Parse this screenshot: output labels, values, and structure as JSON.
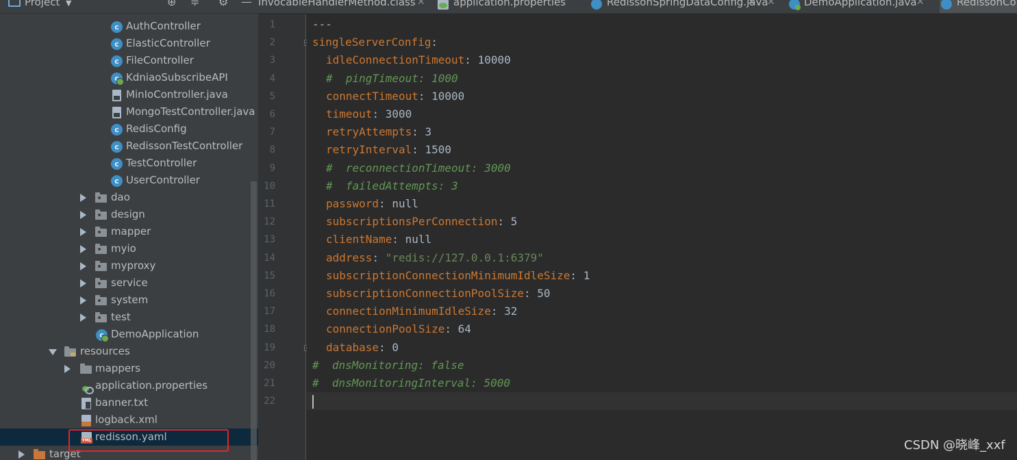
{
  "sidebar": {
    "title": "Project",
    "items": [
      {
        "label": "AuthController",
        "icon": "class"
      },
      {
        "label": "ElasticController",
        "icon": "class"
      },
      {
        "label": "FileController",
        "icon": "class"
      },
      {
        "label": "KdniaoSubscribeAPI",
        "icon": "spring"
      },
      {
        "label": "MinIoController.java",
        "icon": "java-file"
      },
      {
        "label": "MongoTestController.java",
        "icon": "java-file"
      },
      {
        "label": "RedisConfig",
        "icon": "class"
      },
      {
        "label": "RedissonTestController",
        "icon": "class"
      },
      {
        "label": "TestController",
        "icon": "class"
      },
      {
        "label": "UserController",
        "icon": "class"
      },
      {
        "label": "dao",
        "icon": "package"
      },
      {
        "label": "design",
        "icon": "package"
      },
      {
        "label": "mapper",
        "icon": "package"
      },
      {
        "label": "myio",
        "icon": "package"
      },
      {
        "label": "myproxy",
        "icon": "package"
      },
      {
        "label": "service",
        "icon": "package"
      },
      {
        "label": "system",
        "icon": "package"
      },
      {
        "label": "test",
        "icon": "package"
      },
      {
        "label": "DemoApplication",
        "icon": "spring"
      },
      {
        "label": "resources",
        "icon": "resources-folder"
      },
      {
        "label": "mappers",
        "icon": "folder"
      },
      {
        "label": "application.properties",
        "icon": "properties"
      },
      {
        "label": "banner.txt",
        "icon": "text-file"
      },
      {
        "label": "logback.xml",
        "icon": "xml-file"
      },
      {
        "label": "redisson.yaml",
        "icon": "yaml-file"
      },
      {
        "label": "target",
        "icon": "excluded-folder"
      }
    ]
  },
  "tabs": [
    {
      "label": "InvocableHandlerMethod.class"
    },
    {
      "label": "application.properties"
    },
    {
      "label": "RedissonSpringDataConfig.java"
    },
    {
      "label": "DemoApplication.java"
    },
    {
      "label": "RedissonCo"
    }
  ],
  "editor": {
    "line_numbers": [
      "1",
      "2",
      "3",
      "4",
      "5",
      "6",
      "7",
      "8",
      "9",
      "10",
      "11",
      "12",
      "13",
      "14",
      "15",
      "16",
      "17",
      "18",
      "19",
      "20",
      "21",
      "22"
    ],
    "lines": [
      {
        "key": "",
        "value": "---"
      },
      {
        "key": "singleServerConfig",
        "value": ""
      },
      {
        "key": "idleConnectionTimeout",
        "value": "10000"
      },
      {
        "comment": "#  pingTimeout: 1000"
      },
      {
        "key": "connectTimeout",
        "value": "10000"
      },
      {
        "key": "timeout",
        "value": "3000"
      },
      {
        "key": "retryAttempts",
        "value": "3"
      },
      {
        "key": "retryInterval",
        "value": "1500"
      },
      {
        "comment": "#  reconnectionTimeout: 3000"
      },
      {
        "comment": "#  failedAttempts: 3"
      },
      {
        "key": "password",
        "value": "null"
      },
      {
        "key": "subscriptionsPerConnection",
        "value": "5"
      },
      {
        "key": "clientName",
        "value": "null"
      },
      {
        "key": "address",
        "value": "\"redis://127.0.0.1:6379\""
      },
      {
        "key": "subscriptionConnectionMinimumIdleSize",
        "value": "1"
      },
      {
        "key": "subscriptionConnectionPoolSize",
        "value": "50"
      },
      {
        "key": "connectionMinimumIdleSize",
        "value": "32"
      },
      {
        "key": "connectionPoolSize",
        "value": "64"
      },
      {
        "key": "database",
        "value": "0"
      },
      {
        "comment": "#  dnsMonitoring: false"
      },
      {
        "comment": "#  dnsMonitoringInterval: 5000"
      }
    ]
  },
  "watermark": "CSDN @晓峰_xxf",
  "colors": {
    "key": "#cc7832",
    "value": "#a9b7c6",
    "string": "#6a8759",
    "comment": "#629755",
    "highlight_box": "#e82424"
  }
}
